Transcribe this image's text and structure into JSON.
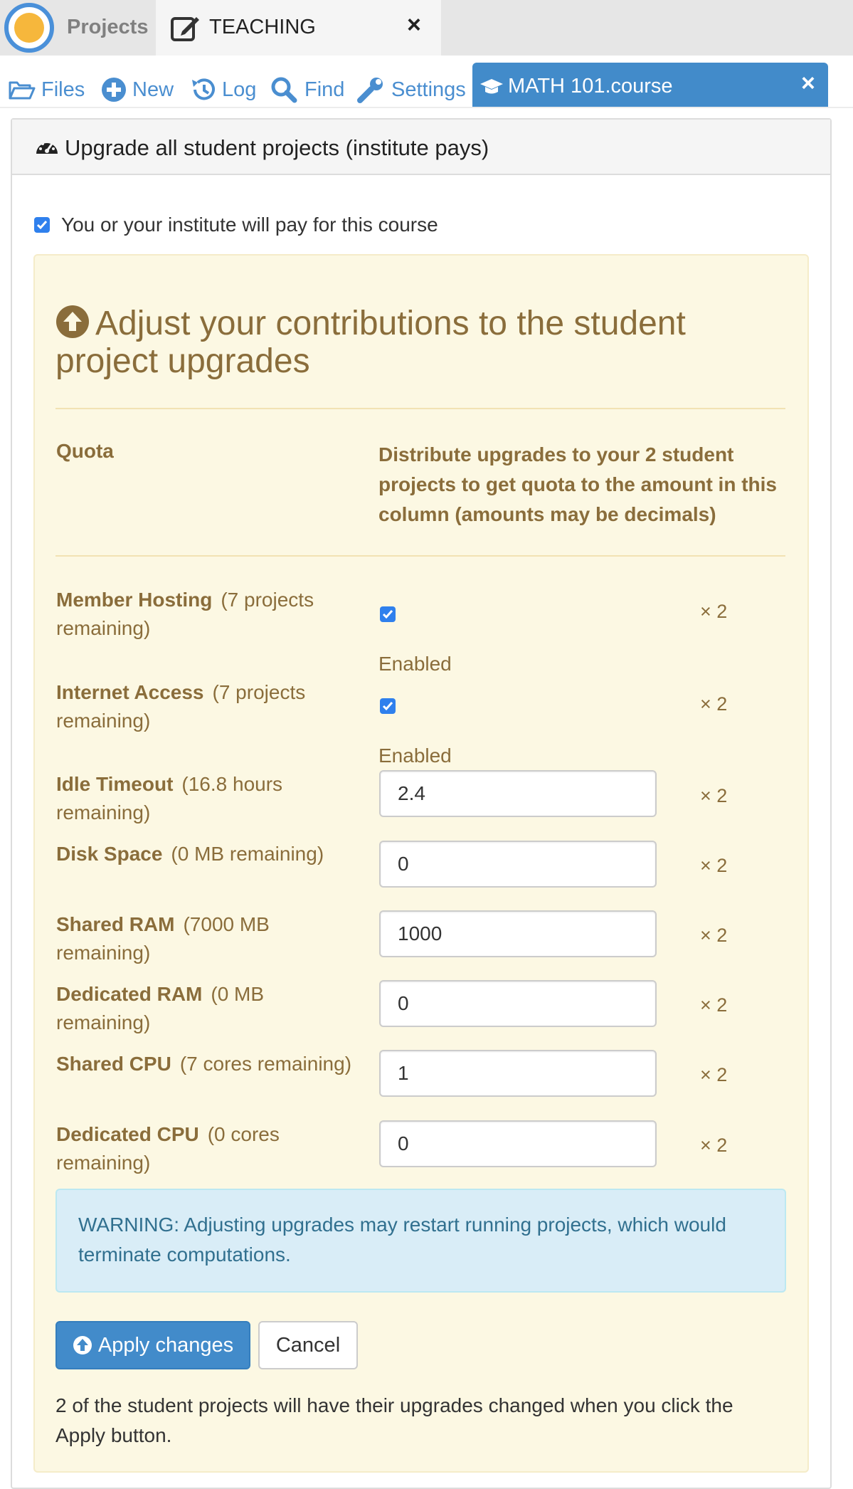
{
  "top_tabs": {
    "projects_label": "Projects",
    "teaching_label": "TEACHING",
    "close_glyph": "×"
  },
  "nav": {
    "files": "Files",
    "new": "New",
    "log": "Log",
    "find": "Find",
    "settings": "Settings",
    "course_tab": "MATH 101.course",
    "course_close": "×"
  },
  "panel": {
    "title": "Upgrade all student projects (institute pays)",
    "pay_label": "You or your institute will pay for this course"
  },
  "upgrades": {
    "heading": "Adjust your contributions to the student project upgrades",
    "col_quota": "Quota",
    "col_distribute": "Distribute upgrades to your 2 student projects to get quota to the amount in this column (amounts may be decimals)",
    "multiplier": "× 2",
    "enabled_label": "Enabled",
    "rows": [
      {
        "name": "Member Hosting",
        "remaining": "(7 projects remaining)",
        "type": "checkbox",
        "checked": true
      },
      {
        "name": "Internet Access",
        "remaining": "(7 projects remaining)",
        "type": "checkbox",
        "checked": true
      },
      {
        "name": "Idle Timeout",
        "remaining": "(16.8 hours remaining)",
        "type": "input",
        "value": "2.4"
      },
      {
        "name": "Disk Space",
        "remaining": "(0 MB remaining)",
        "type": "input",
        "value": "0"
      },
      {
        "name": "Shared RAM",
        "remaining": "(7000 MB remaining)",
        "type": "input",
        "value": "1000"
      },
      {
        "name": "Dedicated RAM",
        "remaining": "(0 MB remaining)",
        "type": "input",
        "value": "0"
      },
      {
        "name": "Shared CPU",
        "remaining": "(7 cores remaining)",
        "type": "input",
        "value": "1"
      },
      {
        "name": "Dedicated CPU",
        "remaining": "(0 cores remaining)",
        "type": "input",
        "value": "0"
      }
    ],
    "warning": "WARNING: Adjusting upgrades may restart running projects, which would terminate computations.",
    "apply_label": "Apply changes",
    "cancel_label": "Cancel",
    "footer_note": "2 of the student projects will have their upgrades changed when you click the Apply button."
  },
  "colors": {
    "accent_blue": "#428bca",
    "link_blue": "#4a8ed0",
    "warning_text": "#8a6d3b",
    "info_text": "#31708f"
  }
}
